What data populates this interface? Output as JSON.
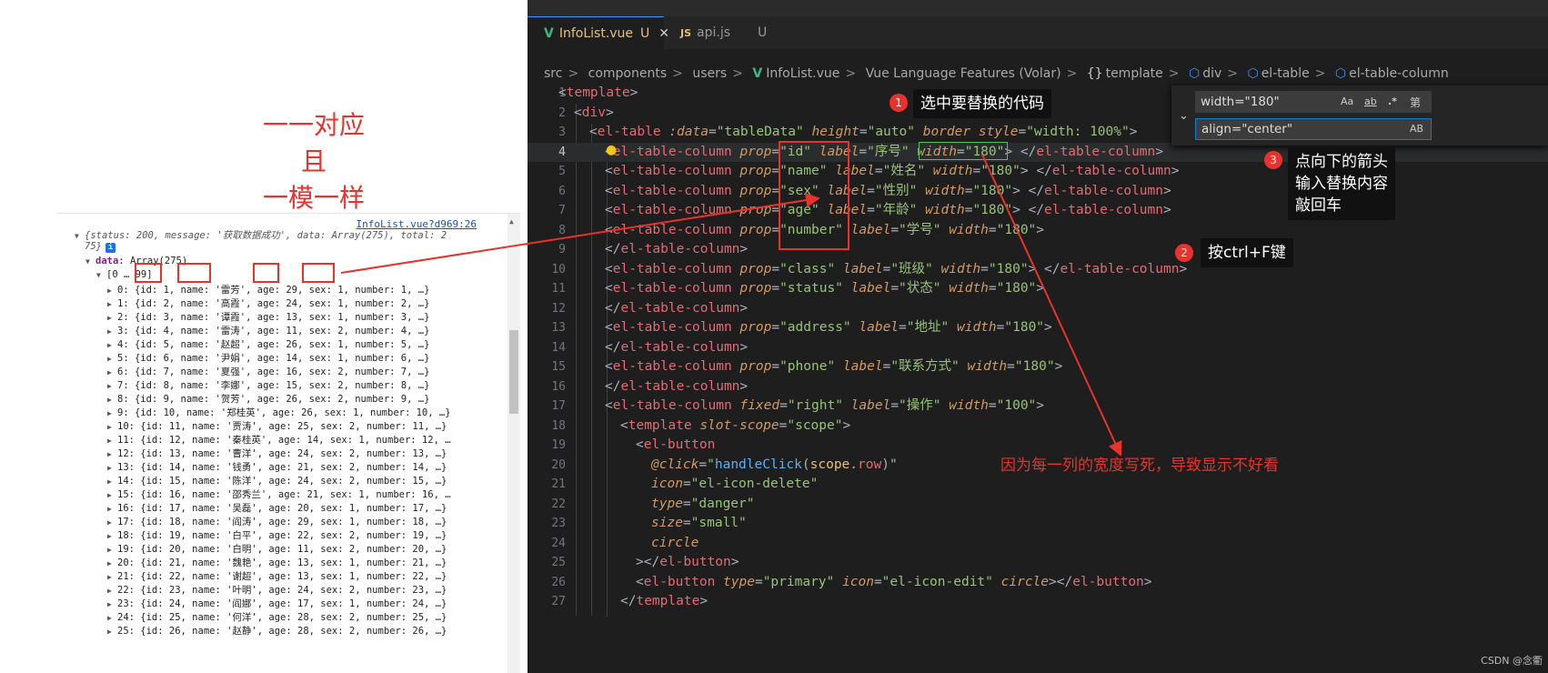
{
  "left_annotation": {
    "lines": [
      "一一对应",
      "且",
      "一模一样"
    ]
  },
  "console": {
    "source_link": "InfoList.vue?d969:26",
    "summary_line1": "{status: 200, message: '获取数据成功', data: Array(275), total: 2",
    "summary_line2": "75}",
    "info_icon": "i",
    "data_label": "data",
    "data_value": "Array(275)",
    "range_label": "[0 … 99]",
    "rows": [
      "0: {id: 1, name: '雷芳', age: 29, sex: 1, number: 1, …}",
      "1: {id: 2, name: '高霞', age: 24, sex: 1, number: 2, …}",
      "2: {id: 3, name: '谭霞', age: 13, sex: 1, number: 3, …}",
      "3: {id: 4, name: '雷涛', age: 11, sex: 2, number: 4, …}",
      "4: {id: 5, name: '赵超', age: 26, sex: 1, number: 5, …}",
      "5: {id: 6, name: '尹娟', age: 14, sex: 1, number: 6, …}",
      "6: {id: 7, name: '夏强', age: 16, sex: 2, number: 7, …}",
      "7: {id: 8, name: '李娜', age: 15, sex: 2, number: 8, …}",
      "8: {id: 9, name: '贺芳', age: 26, sex: 2, number: 9, …}",
      "9: {id: 10, name: '郑桂英', age: 26, sex: 1, number: 10, …}",
      "10: {id: 11, name: '贾涛', age: 25, sex: 2, number: 11, …}",
      "11: {id: 12, name: '秦桂英', age: 14, sex: 1, number: 12, …",
      "12: {id: 13, name: '曹洋', age: 24, sex: 2, number: 13, …}",
      "13: {id: 14, name: '钱勇', age: 21, sex: 2, number: 14, …}",
      "14: {id: 15, name: '陈洋', age: 24, sex: 2, number: 15, …}",
      "15: {id: 16, name: '邵秀兰', age: 21, sex: 1, number: 16, …",
      "16: {id: 17, name: '吴磊', age: 20, sex: 1, number: 17, …}",
      "17: {id: 18, name: '阎涛', age: 29, sex: 1, number: 18, …}",
      "18: {id: 19, name: '白平', age: 22, sex: 2, number: 19, …}",
      "19: {id: 20, name: '白明', age: 11, sex: 2, number: 20, …}",
      "20: {id: 21, name: '魏艳', age: 13, sex: 1, number: 21, …}",
      "21: {id: 22, name: '谢超', age: 13, sex: 1, number: 22, …}",
      "22: {id: 23, name: '叶明', age: 24, sex: 2, number: 23, …}",
      "23: {id: 24, name: '阎娜', age: 17, sex: 1, number: 24, …}",
      "24: {id: 25, name: '何洋', age: 28, sex: 2, number: 25, …}",
      "25: {id: 26, name: '赵静', age: 28, sex: 2, number: 26, …}"
    ]
  },
  "editor": {
    "tabs": [
      {
        "label": "InfoList.vue",
        "modified": "U",
        "close": "✕",
        "icon": "vue-icon"
      },
      {
        "label": "api.js",
        "modified": "U",
        "icon": "js-icon"
      }
    ],
    "breadcrumb": [
      "src",
      "components",
      "users",
      "InfoList.vue",
      "Vue Language Features (Volar)",
      "template",
      "div",
      "el-table",
      "el-table-column"
    ],
    "breadcrumb_icons": {
      "vue": "V",
      "braces": "{}",
      "cube": "⬡"
    },
    "line_numbers": [
      "1",
      "2",
      "3",
      "4",
      "5",
      "6",
      "7",
      "8",
      "9",
      "10",
      "11",
      "12",
      "13",
      "14",
      "15",
      "16",
      "17",
      "18",
      "19",
      "20",
      "21",
      "22",
      "23",
      "24",
      "25",
      "26",
      "27"
    ],
    "find_widget": {
      "find_value": "width=\"180\"",
      "replace_value": "align=\"center\"",
      "option_case": "Aa",
      "option_word": "ab",
      "option_regex": ".*",
      "option_preserve": "AB",
      "extra_label": "第"
    }
  },
  "annotations": {
    "marker1": "1",
    "callout1": "选中要替换的代码",
    "marker2": "2",
    "callout2": "按ctrl+F键",
    "marker3": "3",
    "callout3_lines": [
      "点向下的箭头",
      "输入替换内容",
      "敲回车"
    ],
    "red_note": "因为每一列的宽度写死，导致显示不好看"
  },
  "watermark": "CSDN @念衢"
}
